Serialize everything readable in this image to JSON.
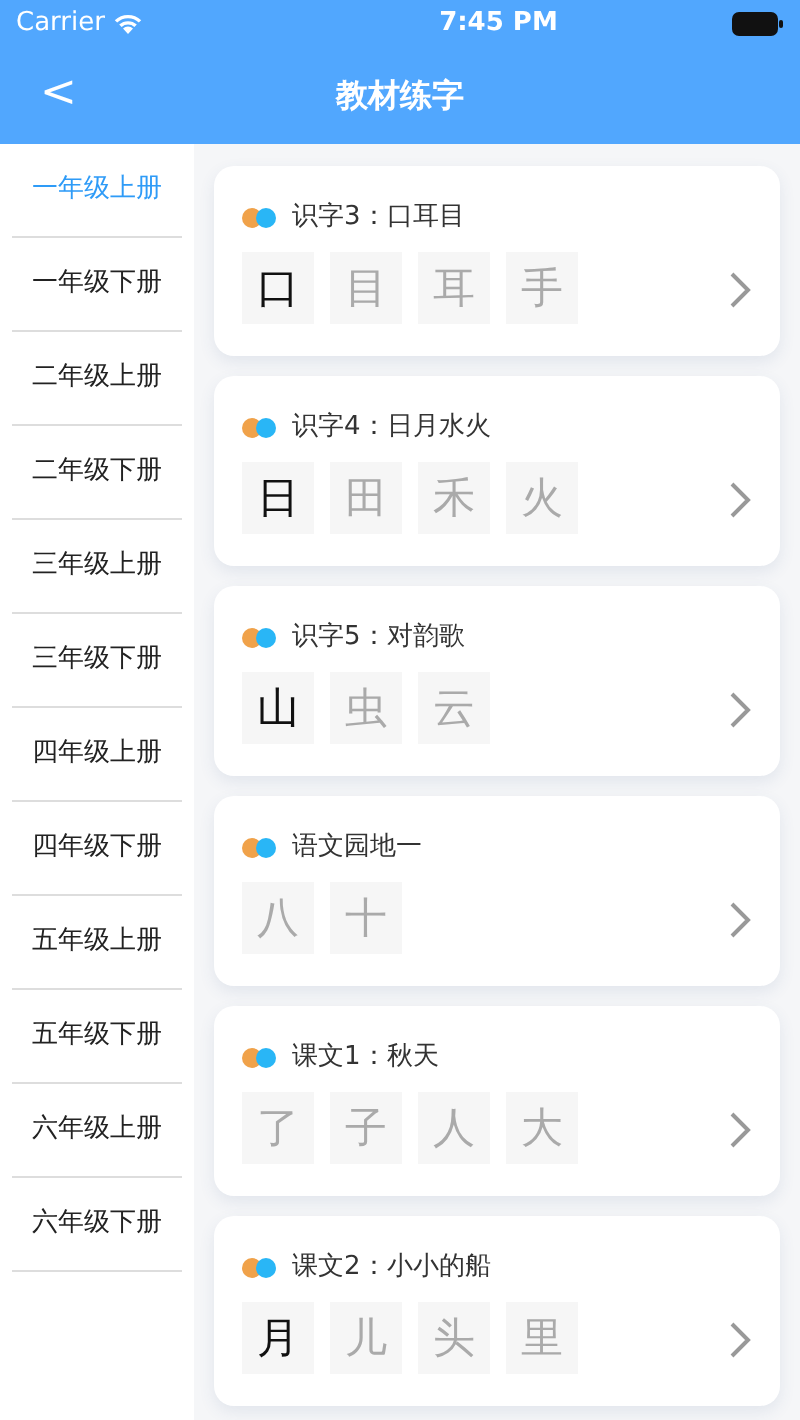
{
  "status_bar": {
    "carrier": "Carrier",
    "time": "7:45 PM"
  },
  "nav": {
    "back": "<",
    "title": "教材练字"
  },
  "sidebar": {
    "items": [
      {
        "label": "一年级上册",
        "selected": true
      },
      {
        "label": "一年级下册",
        "selected": false
      },
      {
        "label": "二年级上册",
        "selected": false
      },
      {
        "label": "二年级下册",
        "selected": false
      },
      {
        "label": "三年级上册",
        "selected": false
      },
      {
        "label": "三年级下册",
        "selected": false
      },
      {
        "label": "四年级上册",
        "selected": false
      },
      {
        "label": "四年级下册",
        "selected": false
      },
      {
        "label": "五年级上册",
        "selected": false
      },
      {
        "label": "五年级下册",
        "selected": false
      },
      {
        "label": "六年级上册",
        "selected": false
      },
      {
        "label": "六年级下册",
        "selected": false
      }
    ]
  },
  "lessons": [
    {
      "title": "识字3：口耳目",
      "chars": [
        {
          "char": "口",
          "practiced": true
        },
        {
          "char": "目",
          "practiced": false
        },
        {
          "char": "耳",
          "practiced": false
        },
        {
          "char": "手",
          "practiced": false
        }
      ]
    },
    {
      "title": "识字4：日月水火",
      "chars": [
        {
          "char": "日",
          "practiced": true
        },
        {
          "char": "田",
          "practiced": false
        },
        {
          "char": "禾",
          "practiced": false
        },
        {
          "char": "火",
          "practiced": false
        }
      ]
    },
    {
      "title": "识字5：对韵歌",
      "chars": [
        {
          "char": "山",
          "practiced": true
        },
        {
          "char": "虫",
          "practiced": false
        },
        {
          "char": "云",
          "practiced": false
        }
      ]
    },
    {
      "title": "语文园地一",
      "chars": [
        {
          "char": "八",
          "practiced": false
        },
        {
          "char": "十",
          "practiced": false
        }
      ]
    },
    {
      "title": "课文1：秋天",
      "chars": [
        {
          "char": "了",
          "practiced": false
        },
        {
          "char": "子",
          "practiced": false
        },
        {
          "char": "人",
          "practiced": false
        },
        {
          "char": "大",
          "practiced": false
        }
      ]
    },
    {
      "title": "课文2：小小的船",
      "chars": [
        {
          "char": "月",
          "practiced": true
        },
        {
          "char": "儿",
          "practiced": false
        },
        {
          "char": "头",
          "practiced": false
        },
        {
          "char": "里",
          "practiced": false
        }
      ]
    }
  ]
}
